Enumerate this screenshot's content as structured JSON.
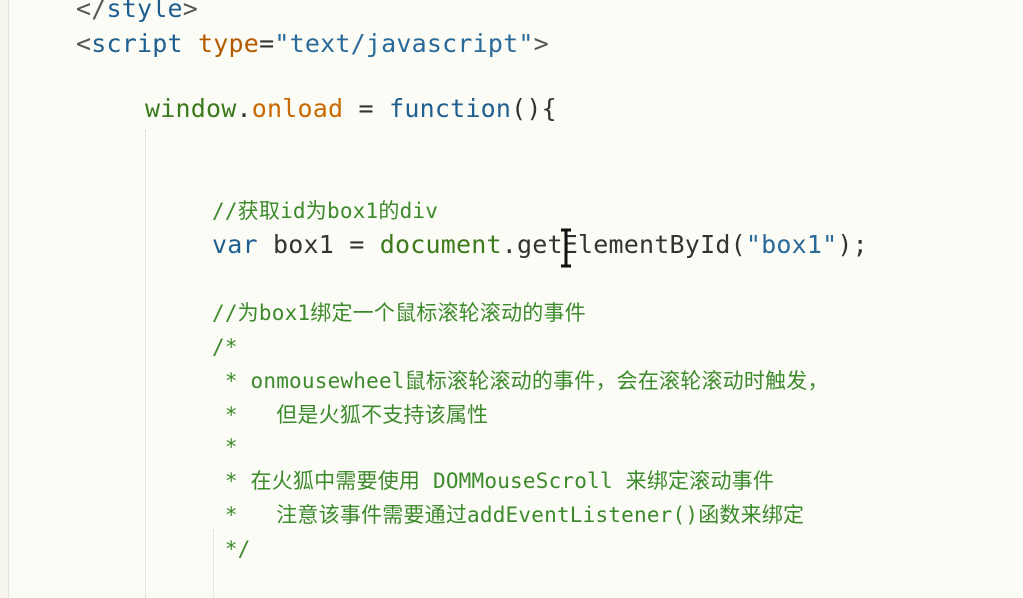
{
  "editor": {
    "lines": [
      {
        "tokens": [
          {
            "t": "</",
            "c": "tok-tag"
          },
          {
            "t": "style",
            "c": "tok-blue"
          },
          {
            "t": ">",
            "c": "tok-tag"
          }
        ]
      },
      {
        "tokens": [
          {
            "t": "<",
            "c": "tok-tag"
          },
          {
            "t": "script",
            "c": "tok-blue"
          },
          {
            "t": " ",
            "c": "tok-text"
          },
          {
            "t": "type",
            "c": "tok-attr"
          },
          {
            "t": "=",
            "c": "tok-punc"
          },
          {
            "t": "\"text/javascript\"",
            "c": "tok-str"
          },
          {
            "t": ">",
            "c": "tok-tag"
          }
        ]
      },
      {
        "tokens": [
          {
            "t": "window",
            "c": "tok-green"
          },
          {
            "t": ".",
            "c": "tok-punc"
          },
          {
            "t": "onload",
            "c": "tok-orange"
          },
          {
            "t": " = ",
            "c": "tok-punc"
          },
          {
            "t": "function",
            "c": "tok-blue"
          },
          {
            "t": "(){",
            "c": "tok-text"
          }
        ]
      },
      {
        "tokens": [
          {
            "t": "//获取",
            "c": "tok-comment"
          },
          {
            "t": "id",
            "c": "tok-comment"
          },
          {
            "t": "为",
            "c": "tok-comment"
          },
          {
            "t": "box1",
            "c": "tok-comment"
          },
          {
            "t": "的",
            "c": "tok-comment"
          },
          {
            "t": "div",
            "c": "tok-comment"
          }
        ]
      },
      {
        "tokens": [
          {
            "t": "var",
            "c": "tok-blue"
          },
          {
            "t": " box1 = ",
            "c": "tok-text"
          },
          {
            "t": "document",
            "c": "tok-green"
          },
          {
            "t": ".getElementById(",
            "c": "tok-text"
          },
          {
            "t": "\"box1\"",
            "c": "tok-str"
          },
          {
            "t": ");",
            "c": "tok-text"
          }
        ]
      },
      {
        "tokens": [
          {
            "t": "//为",
            "c": "tok-comment"
          },
          {
            "t": "box1",
            "c": "tok-comment"
          },
          {
            "t": "绑定一个鼠标滚轮滚动的事件",
            "c": "tok-comment"
          }
        ]
      },
      {
        "tokens": [
          {
            "t": "/*",
            "c": "tok-comment"
          }
        ]
      },
      {
        "tokens": [
          {
            "t": " * ",
            "c": "tok-comment"
          },
          {
            "t": "onmousewheel",
            "c": "tok-comment"
          },
          {
            "t": "鼠标滚轮滚动的事件，会在滚轮滚动时触发，",
            "c": "tok-comment"
          }
        ]
      },
      {
        "tokens": [
          {
            "t": " *   但是火狐不支持该属性",
            "c": "tok-comment"
          }
        ]
      },
      {
        "tokens": [
          {
            "t": " *",
            "c": "tok-comment"
          }
        ]
      },
      {
        "tokens": [
          {
            "t": " * 在火狐中需要使用 ",
            "c": "tok-comment"
          },
          {
            "t": "DOMMouseScroll",
            "c": "tok-comment"
          },
          {
            "t": " 来绑定滚动事件",
            "c": "tok-comment"
          }
        ]
      },
      {
        "tokens": [
          {
            "t": " *   注意该事件需要通过",
            "c": "tok-comment"
          },
          {
            "t": "addEventListener()",
            "c": "tok-comment"
          },
          {
            "t": "函数来绑定",
            "c": "tok-comment"
          }
        ]
      },
      {
        "tokens": [
          {
            "t": " */",
            "c": "tok-comment"
          }
        ]
      }
    ]
  }
}
